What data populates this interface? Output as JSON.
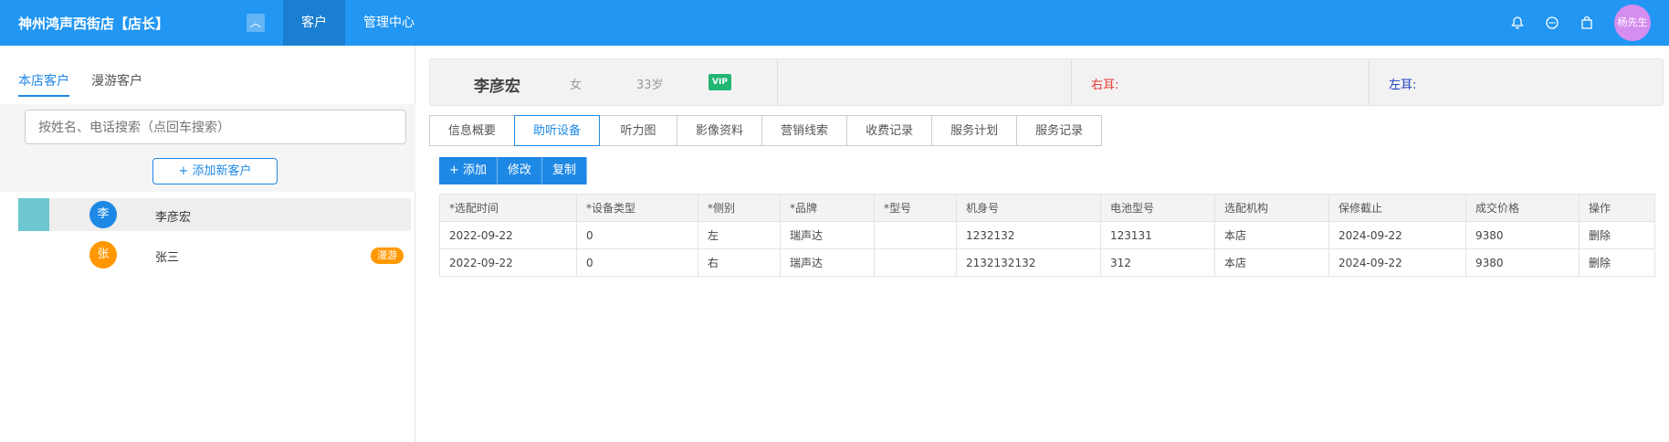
{
  "topbar": {
    "brand": "神州鸿声西街店【店长】",
    "collapse_icon": "chevron-up-icon",
    "nav": [
      {
        "label": "客户"
      },
      {
        "label": "管理中心"
      }
    ],
    "user": "杨先生",
    "brand_color": "#2196f3"
  },
  "left": {
    "tabs": [
      {
        "label": "本店客户"
      },
      {
        "label": "漫游客户"
      }
    ],
    "search_placeholder": "按姓名、电话搜索（点回车搜索）",
    "add_label": "+ 添加新客户",
    "customers": [
      {
        "avatar": "李",
        "name": "李彦宏",
        "badge": "",
        "avatar_color": "#1e88e5"
      },
      {
        "avatar": "张",
        "name": "张三",
        "badge": "漫游",
        "avatar_color": "#ff9800"
      }
    ]
  },
  "header": {
    "name": "李彦宏",
    "sex": "女",
    "age": "33岁",
    "vip": "VIP",
    "right_ear": "右耳:",
    "left_ear": "左耳:"
  },
  "subtabs": [
    {
      "label": "信息概要"
    },
    {
      "label": "助听设备"
    },
    {
      "label": "听力图"
    },
    {
      "label": "影像资料"
    },
    {
      "label": "营销线索"
    },
    {
      "label": "收费记录"
    },
    {
      "label": "服务计划"
    },
    {
      "label": "服务记录"
    }
  ],
  "actions": {
    "add": "+ 添加",
    "edit": "修改",
    "copy": "复制"
  },
  "table": {
    "headers": [
      "*选配时间",
      "*设备类型",
      "*侧别",
      "*品牌",
      "*型号",
      "机身号",
      "电池型号",
      "选配机构",
      "保修截止",
      "成交价格",
      "操作"
    ],
    "rows": [
      [
        "2022-09-22",
        "0",
        "左",
        "瑞声达",
        "",
        "1232132",
        "123131",
        "本店",
        "2024-09-22",
        "9380",
        "删除"
      ],
      [
        "2022-09-22",
        "0",
        "右",
        "瑞声达",
        "",
        "2132132132",
        "312",
        "本店",
        "2024-09-22",
        "9380",
        "删除"
      ]
    ]
  }
}
